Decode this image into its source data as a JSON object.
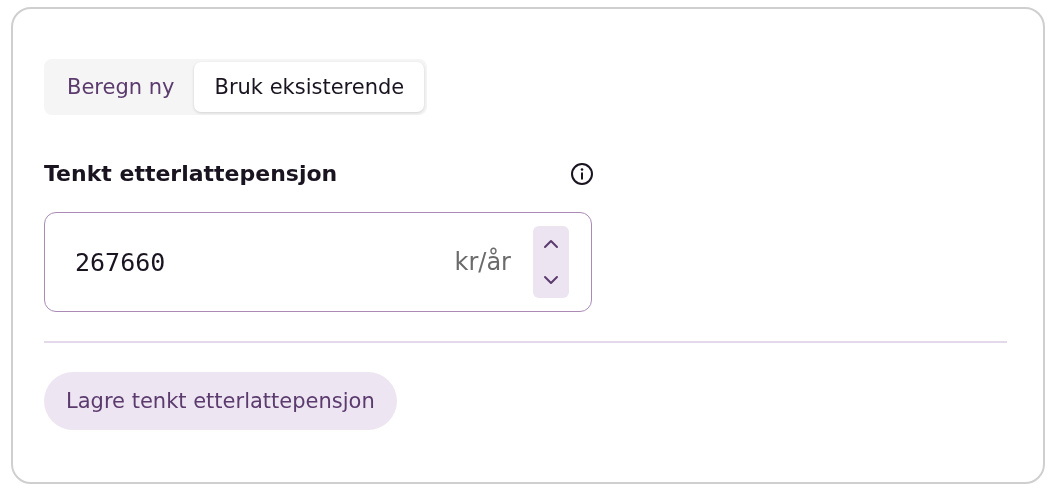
{
  "tabs": [
    {
      "label": "Beregn ny",
      "selected": false
    },
    {
      "label": "Bruk eksisterende",
      "selected": true
    }
  ],
  "field": {
    "label": "Tenkt etterlattepensjon",
    "value": "267660",
    "unit": "kr/år"
  },
  "button": {
    "label": "Lagre tenkt etterlattepensjon"
  }
}
